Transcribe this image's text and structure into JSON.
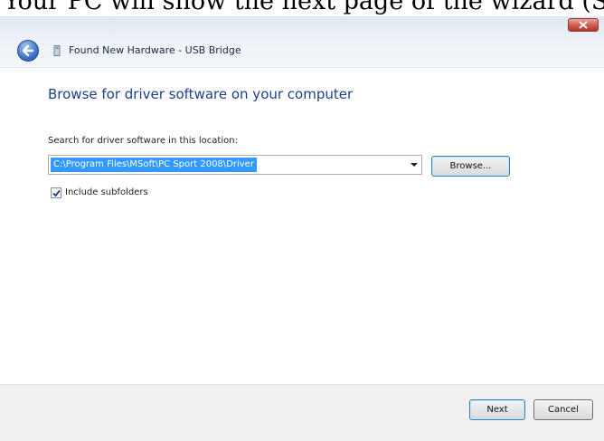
{
  "caption": {
    "text": "Your PC will show the next page of the wizard (S"
  },
  "window": {
    "title": "Found New Hardware - USB Bridge",
    "heading": "Browse for driver software on your computer",
    "search_label": "Search for driver software in this location:",
    "path_value": "C:\\Program Files\\MSoft\\PC Sport 2008\\Driver",
    "browse_label": "Browse...",
    "include_subfolders_label": "Include subfolders",
    "include_subfolders_checked": true,
    "next_label": "Next",
    "cancel_label": "Cancel"
  },
  "icons": {
    "close": "close-icon",
    "back": "back-arrow-icon",
    "hardware": "hardware-icon",
    "dropdown": "chevron-down-icon",
    "check": "checkmark-icon"
  },
  "colors": {
    "heading": "#1e3e8c",
    "selection": "#3399ff",
    "close_button": "#c94b3f"
  }
}
